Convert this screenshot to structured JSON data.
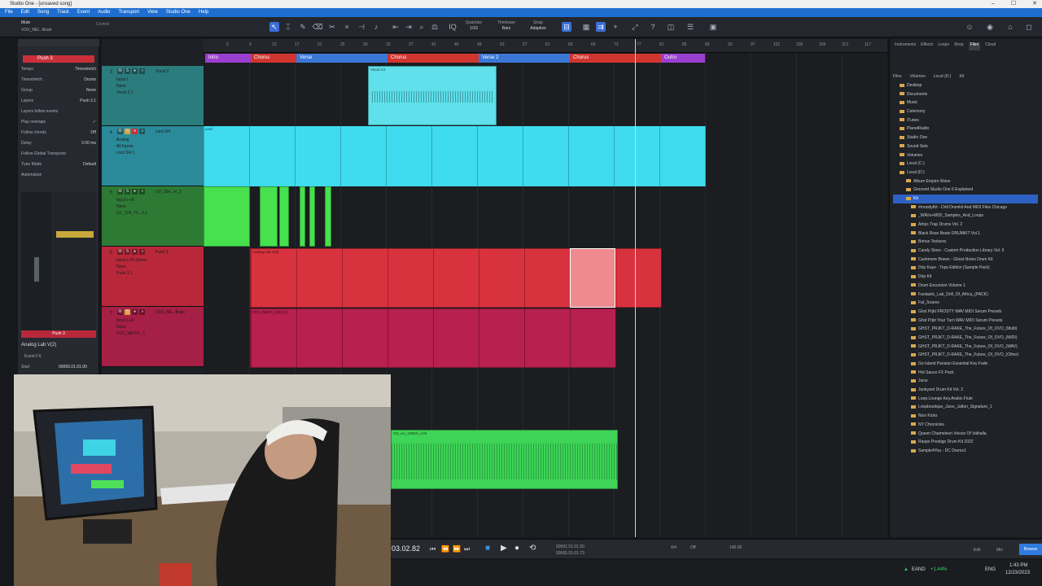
{
  "window": {
    "title": "Studio One - [unsaved song]"
  },
  "menu": [
    "File",
    "Edit",
    "Song",
    "Track",
    "Event",
    "Audio",
    "Transport",
    "View",
    "Studio One",
    "Help"
  ],
  "toolbar": {
    "quantize_label": "Quantize",
    "quantize_value": "1/16",
    "timebase_label": "Timebase",
    "timebase_value": "Bars",
    "snap_label": "Snap",
    "snap_value": "Adaptive"
  },
  "track_header": {
    "name": "VOX_NEI...Brain",
    "mute_label": "Mute",
    "control_label": "Control"
  },
  "inspector": {
    "track": "Push 3",
    "rows": [
      {
        "label": "Tempo",
        "value": "Timestretch"
      },
      {
        "label": "Timestretch",
        "value": "Drums"
      },
      {
        "label": "Group",
        "value": "None"
      },
      {
        "label": "Layers",
        "value": "Push 3.1"
      },
      {
        "label": "Layers follow events",
        "value": ""
      },
      {
        "label": "Play overlaps",
        "value": ""
      },
      {
        "label": "Follow chords",
        "value": "Off"
      },
      {
        "label": "Delay",
        "value": "0.00 ms"
      },
      {
        "label": "Follow Global Transpose",
        "value": ""
      },
      {
        "label": "Tune Mode",
        "value": "Default"
      },
      {
        "label": "Automation",
        "value": ""
      }
    ],
    "channel": "Push 3",
    "instrument": "Analog Lab V(2)",
    "event_fx": "Event FX",
    "start_label": "Start",
    "start_value": "00065.01.01.00"
  },
  "ruler": [
    "5",
    "9",
    "13",
    "17",
    "21",
    "25",
    "29",
    "33",
    "37",
    "41",
    "45",
    "49",
    "53",
    "57",
    "61",
    "65",
    "69",
    "73",
    "77",
    "81",
    "85",
    "89",
    "93",
    "97",
    "101",
    "105",
    "109",
    "113",
    "117"
  ],
  "sections": [
    {
      "name": "Intro",
      "color": "#9b3fd0"
    },
    {
      "name": "Chorus",
      "color": "#d0352f"
    },
    {
      "name": "Verse",
      "color": "#3b78d6"
    },
    {
      "name": "Chorus",
      "color": "#d0352f"
    },
    {
      "name": "Verse 2",
      "color": "#3b78d6"
    },
    {
      "name": "Chorus",
      "color": "#d0352f"
    },
    {
      "name": "Outro",
      "color": "#9b3fd0"
    }
  ],
  "tracks": [
    {
      "num": "3",
      "name": "Vocal 2",
      "io1": "Input L",
      "io2": "None",
      "io3": "Vocal 2.1"
    },
    {
      "num": "4",
      "name": "cord 3/4",
      "io1": "Analog",
      "io2": "All Inputs",
      "io3": "cord 3/4.1"
    },
    {
      "num": "5",
      "name": "UV_104...hi_3",
      "io1": "Input L+R",
      "io2": "None",
      "io3": "UV_124_Th...3.1"
    },
    {
      "num": "6",
      "name": "Push 3",
      "io1": "Input L+R Stereo",
      "io2": "None",
      "io3": "Push 3.1"
    },
    {
      "num": "7",
      "name": "VOX_NE...Brain",
      "io1": "Input L+R",
      "io2": "None",
      "io3": "VOX_NEITH_.1"
    }
  ],
  "clips": {
    "vocal": "Vocal 3.0",
    "cord": "cord",
    "analog": "Analog Lab V(2)",
    "vox": "VOX_NEITH_120_bo",
    "green": "OS_AA_100Ch_Amt"
  },
  "browser": {
    "tabs": [
      "Instruments",
      "Effects",
      "Loops",
      "Shop",
      "Files",
      "Cloud"
    ],
    "path": [
      "Files",
      "Volumes",
      "Local (D:)",
      "Kit"
    ],
    "items": [
      {
        "name": "Desktop",
        "sel": false
      },
      {
        "name": "Documents",
        "sel": false
      },
      {
        "name": "Music",
        "sel": false
      },
      {
        "name": "Celemony",
        "sel": false
      },
      {
        "name": "iTunes",
        "sel": false
      },
      {
        "name": "PlanetRadio",
        "sel": false
      },
      {
        "name": "Studio One",
        "sel": false
      },
      {
        "name": "Sound Sets",
        "sel": false
      },
      {
        "name": "Volumes",
        "sel": false
      },
      {
        "name": "Local (C:)",
        "sel": false
      },
      {
        "name": "Local (D:)",
        "sel": false
      },
      {
        "name": "Album Empire Wave",
        "sel": false
      },
      {
        "name": "Grooved Studio One 6 Explained",
        "sel": false
      },
      {
        "name": "Kit",
        "sel": true
      },
      {
        "name": "#moodyKit - Drill Drumkit And MIDI Files Chicago",
        "sel": false
      },
      {
        "name": "_WAVs+MIDI_Samples_And_Loops",
        "sel": false
      },
      {
        "name": "Arbys Trap Drums Vol. 2",
        "sel": false
      },
      {
        "name": "Black Rose Beatz DRUMKIT Vol.1",
        "sel": false
      },
      {
        "name": "Bonus Textures",
        "sel": false
      },
      {
        "name": "Candy Store - Custom Production Library Vol. II",
        "sel": false
      },
      {
        "name": "Cashmere Brown - Ghost Notes Drum Kit",
        "sel": false
      },
      {
        "name": "Drip Kaye - Tops Edition (Sample Pack)",
        "sel": false
      },
      {
        "name": "Drip Kit",
        "sel": false
      },
      {
        "name": "Drum Excursion Volume 1",
        "sel": false
      },
      {
        "name": "Fantastic_Lab_Drill_Of_Africa_(PACK)",
        "sel": false
      },
      {
        "name": "Fat_Snares",
        "sel": false
      },
      {
        "name": "Ghst Prjkt PROSTY WAV MIDI Serum Presets",
        "sel": false
      },
      {
        "name": "Ghst Prjkt Your Turn WAV MIDI Serum Presets",
        "sel": false
      },
      {
        "name": "GHST_PRJKT_D-RAKE_The_Future_Of_OVO_(Multi)",
        "sel": false
      },
      {
        "name": "GHST_PRJKT_D-RAKE_The_Future_Of_OVO_(MIDI)",
        "sel": false
      },
      {
        "name": "GHST_PRJKT_D-RAKE_The_Future_Of_OVO_(WAV)",
        "sel": false
      },
      {
        "name": "GHST_PRJKT_D-RAKE_The_Future_Of_OVO_(Other)",
        "sel": false
      },
      {
        "name": "Go Island Pansian Essential Key Fade",
        "sel": false
      },
      {
        "name": "Hot Sauce FX Pack",
        "sel": false
      },
      {
        "name": "Juice",
        "sel": false
      },
      {
        "name": "Junkyard Drum Kit Vol. 2",
        "sel": false
      },
      {
        "name": "Loop.Lounge.Key.Arabic.Flute",
        "sel": false
      },
      {
        "name": "Loopboutique_Juice_Jalton_Signature_1",
        "sel": false
      },
      {
        "name": "Nice Kicks",
        "sel": false
      },
      {
        "name": "NY Chronicles",
        "sel": false
      },
      {
        "name": "Queen Chameleon Voices Of Valhalla",
        "sel": false
      },
      {
        "name": "Raspo Prestige Drum Kit 2022",
        "sel": false
      },
      {
        "name": "Sample4You - DC Drums1",
        "sel": false
      }
    ]
  },
  "transport": {
    "time": "03.02.82",
    "position1": "00001.01.01.00",
    "position2": "00065.01.01.73",
    "signature": "4/4",
    "metronome": "Off",
    "tempo": "140.00",
    "edit": "Edit",
    "mix": "Mix",
    "browse": "Browse"
  },
  "taskbar": {
    "ticker": "EAND",
    "change": "+1.44%",
    "lang": "ENG",
    "time": "1:43 PM",
    "date": "12/23/2023"
  }
}
